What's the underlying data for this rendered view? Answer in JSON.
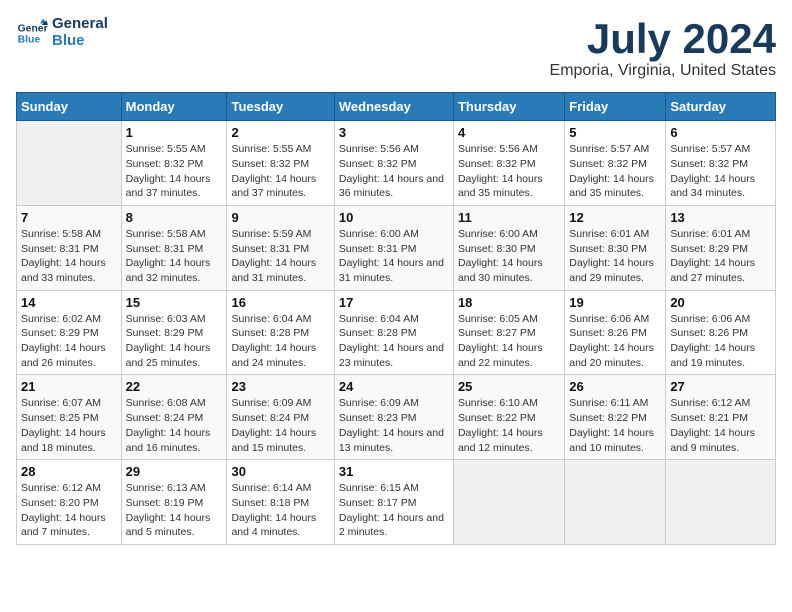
{
  "logo": {
    "line1": "General",
    "line2": "Blue"
  },
  "title": "July 2024",
  "subtitle": "Emporia, Virginia, United States",
  "days_header": [
    "Sunday",
    "Monday",
    "Tuesday",
    "Wednesday",
    "Thursday",
    "Friday",
    "Saturday"
  ],
  "weeks": [
    [
      {
        "day": "",
        "sunrise": "",
        "sunset": "",
        "daylight": ""
      },
      {
        "day": "1",
        "sunrise": "Sunrise: 5:55 AM",
        "sunset": "Sunset: 8:32 PM",
        "daylight": "Daylight: 14 hours and 37 minutes."
      },
      {
        "day": "2",
        "sunrise": "Sunrise: 5:55 AM",
        "sunset": "Sunset: 8:32 PM",
        "daylight": "Daylight: 14 hours and 37 minutes."
      },
      {
        "day": "3",
        "sunrise": "Sunrise: 5:56 AM",
        "sunset": "Sunset: 8:32 PM",
        "daylight": "Daylight: 14 hours and 36 minutes."
      },
      {
        "day": "4",
        "sunrise": "Sunrise: 5:56 AM",
        "sunset": "Sunset: 8:32 PM",
        "daylight": "Daylight: 14 hours and 35 minutes."
      },
      {
        "day": "5",
        "sunrise": "Sunrise: 5:57 AM",
        "sunset": "Sunset: 8:32 PM",
        "daylight": "Daylight: 14 hours and 35 minutes."
      },
      {
        "day": "6",
        "sunrise": "Sunrise: 5:57 AM",
        "sunset": "Sunset: 8:32 PM",
        "daylight": "Daylight: 14 hours and 34 minutes."
      }
    ],
    [
      {
        "day": "7",
        "sunrise": "Sunrise: 5:58 AM",
        "sunset": "Sunset: 8:31 PM",
        "daylight": "Daylight: 14 hours and 33 minutes."
      },
      {
        "day": "8",
        "sunrise": "Sunrise: 5:58 AM",
        "sunset": "Sunset: 8:31 PM",
        "daylight": "Daylight: 14 hours and 32 minutes."
      },
      {
        "day": "9",
        "sunrise": "Sunrise: 5:59 AM",
        "sunset": "Sunset: 8:31 PM",
        "daylight": "Daylight: 14 hours and 31 minutes."
      },
      {
        "day": "10",
        "sunrise": "Sunrise: 6:00 AM",
        "sunset": "Sunset: 8:31 PM",
        "daylight": "Daylight: 14 hours and 31 minutes."
      },
      {
        "day": "11",
        "sunrise": "Sunrise: 6:00 AM",
        "sunset": "Sunset: 8:30 PM",
        "daylight": "Daylight: 14 hours and 30 minutes."
      },
      {
        "day": "12",
        "sunrise": "Sunrise: 6:01 AM",
        "sunset": "Sunset: 8:30 PM",
        "daylight": "Daylight: 14 hours and 29 minutes."
      },
      {
        "day": "13",
        "sunrise": "Sunrise: 6:01 AM",
        "sunset": "Sunset: 8:29 PM",
        "daylight": "Daylight: 14 hours and 27 minutes."
      }
    ],
    [
      {
        "day": "14",
        "sunrise": "Sunrise: 6:02 AM",
        "sunset": "Sunset: 8:29 PM",
        "daylight": "Daylight: 14 hours and 26 minutes."
      },
      {
        "day": "15",
        "sunrise": "Sunrise: 6:03 AM",
        "sunset": "Sunset: 8:29 PM",
        "daylight": "Daylight: 14 hours and 25 minutes."
      },
      {
        "day": "16",
        "sunrise": "Sunrise: 6:04 AM",
        "sunset": "Sunset: 8:28 PM",
        "daylight": "Daylight: 14 hours and 24 minutes."
      },
      {
        "day": "17",
        "sunrise": "Sunrise: 6:04 AM",
        "sunset": "Sunset: 8:28 PM",
        "daylight": "Daylight: 14 hours and 23 minutes."
      },
      {
        "day": "18",
        "sunrise": "Sunrise: 6:05 AM",
        "sunset": "Sunset: 8:27 PM",
        "daylight": "Daylight: 14 hours and 22 minutes."
      },
      {
        "day": "19",
        "sunrise": "Sunrise: 6:06 AM",
        "sunset": "Sunset: 8:26 PM",
        "daylight": "Daylight: 14 hours and 20 minutes."
      },
      {
        "day": "20",
        "sunrise": "Sunrise: 6:06 AM",
        "sunset": "Sunset: 8:26 PM",
        "daylight": "Daylight: 14 hours and 19 minutes."
      }
    ],
    [
      {
        "day": "21",
        "sunrise": "Sunrise: 6:07 AM",
        "sunset": "Sunset: 8:25 PM",
        "daylight": "Daylight: 14 hours and 18 minutes."
      },
      {
        "day": "22",
        "sunrise": "Sunrise: 6:08 AM",
        "sunset": "Sunset: 8:24 PM",
        "daylight": "Daylight: 14 hours and 16 minutes."
      },
      {
        "day": "23",
        "sunrise": "Sunrise: 6:09 AM",
        "sunset": "Sunset: 8:24 PM",
        "daylight": "Daylight: 14 hours and 15 minutes."
      },
      {
        "day": "24",
        "sunrise": "Sunrise: 6:09 AM",
        "sunset": "Sunset: 8:23 PM",
        "daylight": "Daylight: 14 hours and 13 minutes."
      },
      {
        "day": "25",
        "sunrise": "Sunrise: 6:10 AM",
        "sunset": "Sunset: 8:22 PM",
        "daylight": "Daylight: 14 hours and 12 minutes."
      },
      {
        "day": "26",
        "sunrise": "Sunrise: 6:11 AM",
        "sunset": "Sunset: 8:22 PM",
        "daylight": "Daylight: 14 hours and 10 minutes."
      },
      {
        "day": "27",
        "sunrise": "Sunrise: 6:12 AM",
        "sunset": "Sunset: 8:21 PM",
        "daylight": "Daylight: 14 hours and 9 minutes."
      }
    ],
    [
      {
        "day": "28",
        "sunrise": "Sunrise: 6:12 AM",
        "sunset": "Sunset: 8:20 PM",
        "daylight": "Daylight: 14 hours and 7 minutes."
      },
      {
        "day": "29",
        "sunrise": "Sunrise: 6:13 AM",
        "sunset": "Sunset: 8:19 PM",
        "daylight": "Daylight: 14 hours and 5 minutes."
      },
      {
        "day": "30",
        "sunrise": "Sunrise: 6:14 AM",
        "sunset": "Sunset: 8:18 PM",
        "daylight": "Daylight: 14 hours and 4 minutes."
      },
      {
        "day": "31",
        "sunrise": "Sunrise: 6:15 AM",
        "sunset": "Sunset: 8:17 PM",
        "daylight": "Daylight: 14 hours and 2 minutes."
      },
      {
        "day": "",
        "sunrise": "",
        "sunset": "",
        "daylight": ""
      },
      {
        "day": "",
        "sunrise": "",
        "sunset": "",
        "daylight": ""
      },
      {
        "day": "",
        "sunrise": "",
        "sunset": "",
        "daylight": ""
      }
    ]
  ]
}
